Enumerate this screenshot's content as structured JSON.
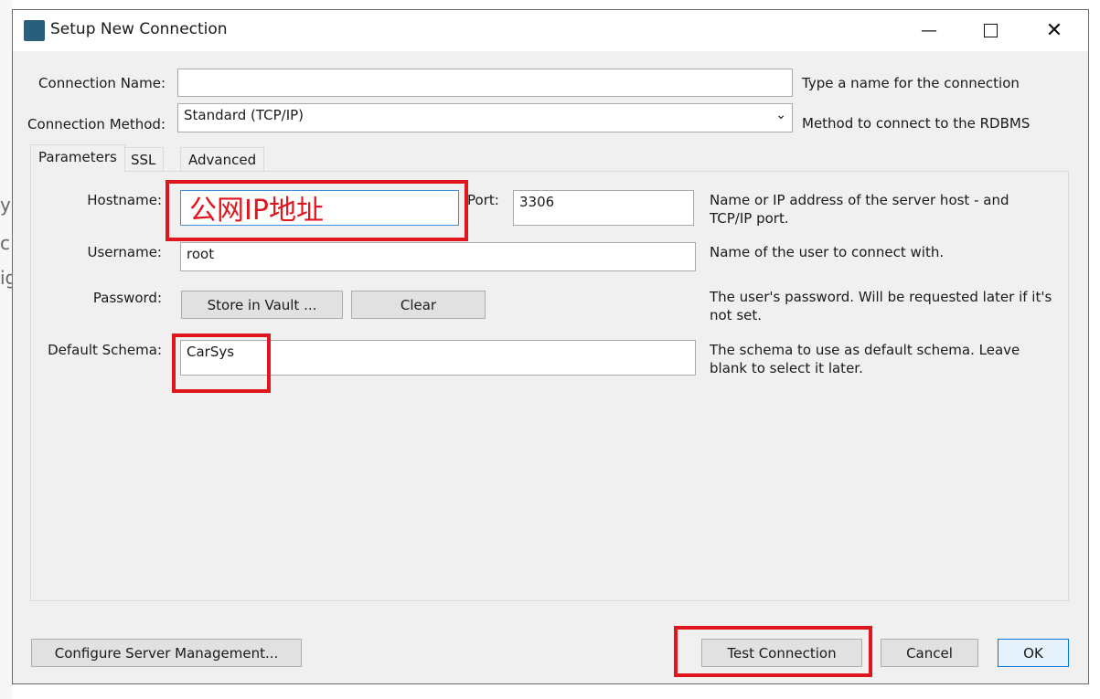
{
  "window": {
    "title": "Setup New Connection",
    "icon": "mysql-workbench-icon"
  },
  "background_fragments": [
    "yS",
    "c",
    "ig"
  ],
  "form": {
    "connection_name": {
      "label": "Connection Name:",
      "value": "",
      "hint": "Type a name for the connection"
    },
    "connection_method": {
      "label": "Connection Method:",
      "value": "Standard (TCP/IP)",
      "hint": "Method to connect to the RDBMS"
    }
  },
  "tabs": [
    {
      "label": "Parameters",
      "active": true
    },
    {
      "label": "SSL"
    },
    {
      "label": "Advanced"
    }
  ],
  "parameters": {
    "hostname": {
      "label": "Hostname:",
      "value": ""
    },
    "port": {
      "label": "Port:",
      "value": "3306"
    },
    "host_hint": "Name or IP address of the server host - and TCP/IP port.",
    "username": {
      "label": "Username:",
      "value": "root",
      "hint": "Name of the user to connect with."
    },
    "password": {
      "label": "Password:",
      "store_button": "Store in Vault ...",
      "clear_button": "Clear",
      "hint": "The user's password. Will be requested later if it's not set."
    },
    "default_schema": {
      "label": "Default Schema:",
      "value": "CarSys",
      "hint": "The schema to use as default schema. Leave blank to select it later."
    }
  },
  "annotation": {
    "text": "公网IP地址",
    "color": "#e0151e"
  },
  "buttons": {
    "configure": "Configure Server Management...",
    "test": "Test Connection",
    "cancel": "Cancel",
    "ok": "OK"
  }
}
